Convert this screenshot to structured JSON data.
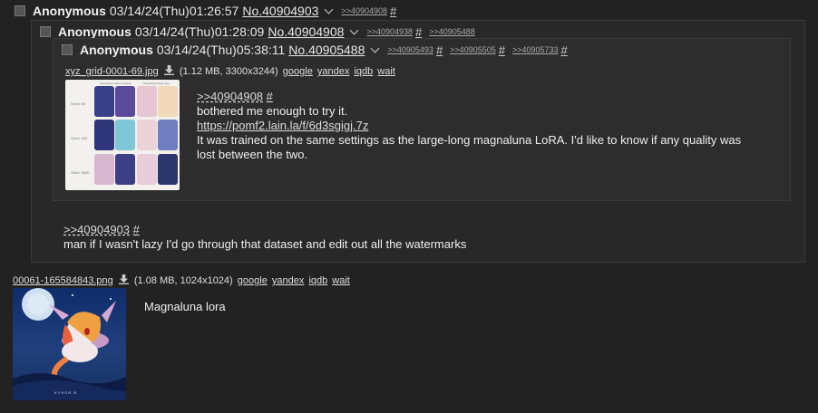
{
  "posts": [
    {
      "name": "Anonymous",
      "date": "03/14/24(Thu)01:26:57",
      "no": "No.40904903",
      "backlinks": [
        ">>40904908"
      ],
      "hash": "#"
    },
    {
      "name": "Anonymous",
      "date": "03/14/24(Thu)01:28:09",
      "no": "No.40904908",
      "backlinks": [
        ">>40904938",
        ">>40905488"
      ],
      "hash": "#",
      "quote": ">>40904903",
      "message": "man if I wasn't lazy I'd go through that dataset and edit out all the watermarks"
    },
    {
      "name": "Anonymous",
      "date": "03/14/24(Thu)05:38:11",
      "no": "No.40905488",
      "backlinks": [
        ">>40905493",
        ">>40905505",
        ">>40905733"
      ],
      "hash": "#",
      "file": {
        "name": "xyz_grid-0001-69.jpg",
        "info": "(1.12 MB, 3300x3244)",
        "links": [
          "google",
          "yandex",
          "iqdb",
          "wait"
        ]
      },
      "quote": ">>40904908",
      "lines": [
        "bothered me enough to try it.",
        "https://pomf2.lain.la/f/6d3sgigj.7z",
        "It was trained on the same settings as the large-long magnaluna LoRA. I'd like to know if any quality was lost between the two."
      ],
      "image_text": {
        "headers": [
          "Magnaluna watermarkless",
          "Magnaluna large long"
        ],
        "rows": [
          "Seed: 69",
          "Seed: 420",
          "Seed: 9000"
        ]
      }
    }
  ],
  "bottom_file": {
    "name": "00061-165584843.png",
    "info": "(1.08 MB, 1024x1024)",
    "links": [
      "google",
      "yandex",
      "iqdb",
      "wait"
    ],
    "caption": "Magnaluna lora",
    "watermark": "KYHOR B"
  },
  "colors": {
    "background": "#222222",
    "reply_box": "#282828",
    "nested_box": "#2d2d2d",
    "text": "#e6e6e6"
  },
  "icons": [
    "checkbox",
    "chevron-down-icon",
    "download-icon"
  ]
}
